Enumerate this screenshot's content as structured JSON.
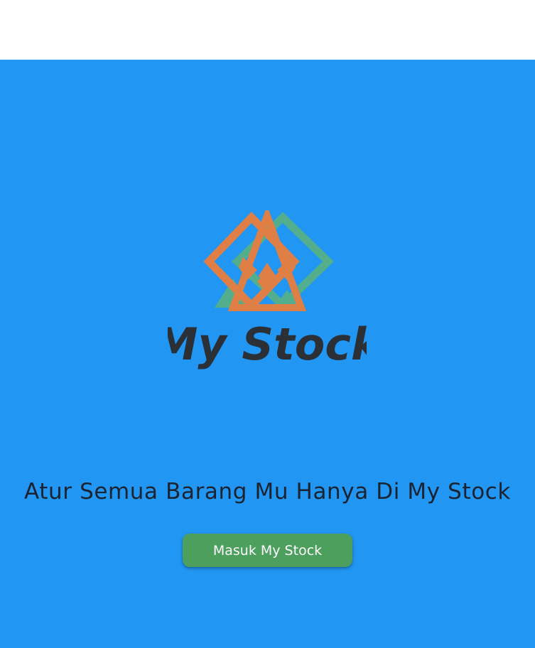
{
  "logo": {
    "text": "My Stock",
    "icon": "mountain-diamond-logo-icon",
    "colors": {
      "orange": "#e07f45",
      "green": "#52ae8c",
      "dark": "#2b2f36"
    }
  },
  "welcome": {
    "tagline": "Atur Semua Barang Mu Hanya Di My Stock",
    "enter_button_label": "Masuk My Stock"
  },
  "theme": {
    "background": "#2196f3",
    "top_bar": "#ffffff",
    "button": "#4c9f5c"
  }
}
